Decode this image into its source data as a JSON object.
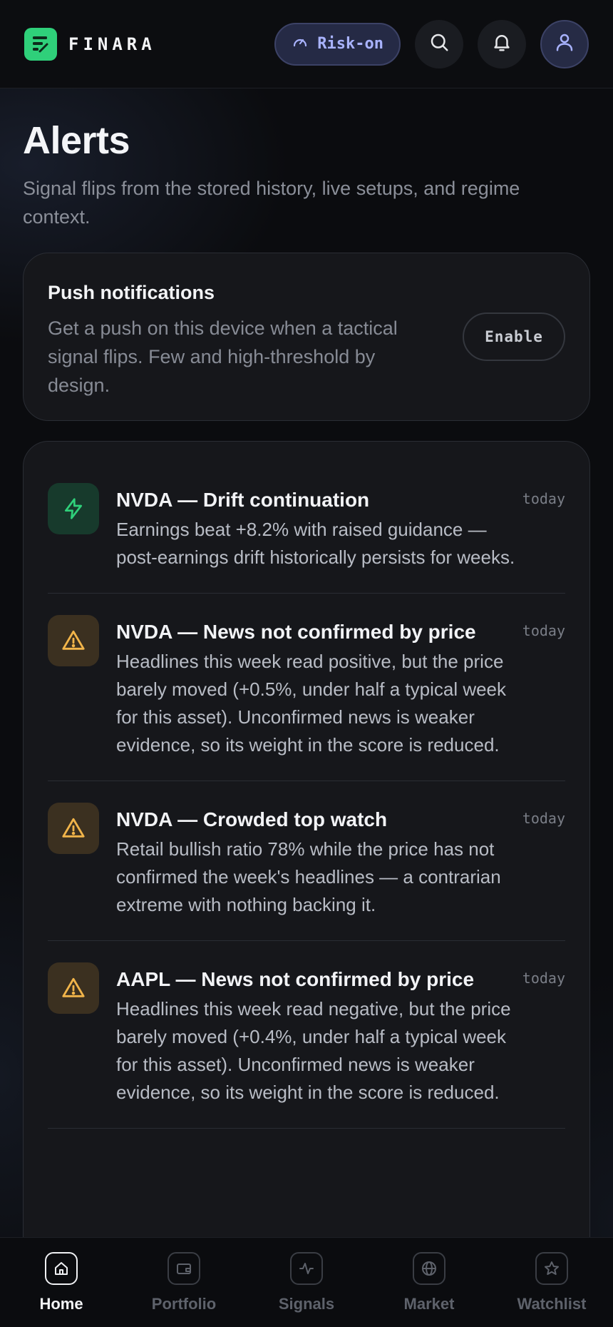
{
  "header": {
    "brand": "FINARA",
    "regime_label": "Risk-on",
    "icons": [
      "logo-icon",
      "gauge-icon",
      "search-icon",
      "bell-icon",
      "user-icon"
    ]
  },
  "page": {
    "title": "Alerts",
    "subtitle": "Signal flips from the stored history, live setups, and regime context."
  },
  "push": {
    "title": "Push notifications",
    "description": "Get a push on this device when a tactical signal flips. Few and high-threshold by design.",
    "button_label": "Enable"
  },
  "alerts": [
    {
      "icon": "bolt-icon",
      "title": "NVDA — Drift continuation",
      "text": "Earnings beat +8.2% with raised guidance — post-earnings drift historically persists for weeks.",
      "time": "today"
    },
    {
      "icon": "warning-icon",
      "title": "NVDA — News not confirmed by price",
      "text": "Headlines this week read positive, but the price barely moved (+0.5%, under half a typical week for this asset). Unconfirmed news is weaker evidence, so its weight in the score is reduced.",
      "time": "today"
    },
    {
      "icon": "warning-icon",
      "title": "NVDA — Crowded top watch",
      "text": "Retail bullish ratio 78% while the price has not confirmed the week's headlines — a contrarian extreme with nothing backing it.",
      "time": "today"
    },
    {
      "icon": "warning-icon",
      "title": "AAPL — News not confirmed by price",
      "text": "Headlines this week read negative, but the price barely moved (+0.4%, under half a typical week for this asset). Unconfirmed news is weaker evidence, so its weight in the score is reduced.",
      "time": "today"
    }
  ],
  "nav": {
    "items": [
      {
        "label": "Home",
        "icon": "home-icon",
        "active": true
      },
      {
        "label": "Portfolio",
        "icon": "wallet-icon",
        "active": false
      },
      {
        "label": "Signals",
        "icon": "activity-icon",
        "active": false
      },
      {
        "label": "Market",
        "icon": "globe-icon",
        "active": false
      },
      {
        "label": "Watchlist",
        "icon": "star-icon",
        "active": false
      }
    ]
  },
  "colors": {
    "accent_green": "#2fd07a",
    "accent_indigo": "#a9b3ff",
    "warning": "#f2b54a",
    "background": "#0b0c0f",
    "card": "#16171b"
  }
}
